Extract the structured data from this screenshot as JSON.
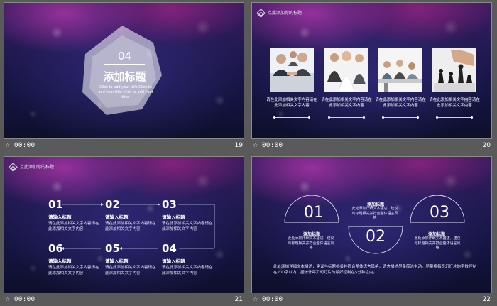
{
  "slides": [
    {
      "number": "19",
      "time": "00:00",
      "section_number": "04",
      "title": "添加标题",
      "subtitle": "Click to add your title Click to add your title Click to add your title."
    },
    {
      "number": "20",
      "time": "00:00",
      "header": "点此添加你的标题",
      "photos": [
        {
          "icon": "business-handshake-photo",
          "caption": "请在此添加相关文字内容请在此添加相关文字内容"
        },
        {
          "icon": "business-team-photo",
          "caption": "请在此添加相关文字内容请在此添加相关文字内容"
        },
        {
          "icon": "office-meeting-photo",
          "caption": "请在此添加相关文字内容请在此添加相关文字内容"
        },
        {
          "icon": "chess-strategy-photo",
          "caption": "请在此添加相关文字内容请在此添加相关文字内容"
        }
      ]
    },
    {
      "number": "21",
      "time": "00:00",
      "header": "点此添加你的标题",
      "steps": [
        {
          "num": "01",
          "title": "请输入标题",
          "desc": "请在此添加相关文字内容请在此添加相关文字内容"
        },
        {
          "num": "02",
          "title": "请输入标题",
          "desc": "请在此添加相关文字内容请在此添加相关文字内容"
        },
        {
          "num": "03",
          "title": "请输入标题",
          "desc": "请在此添加相关文字内容请在此添加相关文字内容"
        },
        {
          "num": "06",
          "title": "请输入标题",
          "desc": "请在此添加相关文字内容请在此添加相关文字内容"
        },
        {
          "num": "05",
          "title": "请输入标题",
          "desc": "请在此添加相关文字内容请在此添加相关文字内容"
        },
        {
          "num": "04",
          "title": "请输入标题",
          "desc": "请在此添加相关文字内容请在此添加相关文字内容"
        }
      ]
    },
    {
      "number": "22",
      "time": "00:00",
      "items": [
        {
          "num": "01",
          "title": "添加标题",
          "desc": "此处添加详细文本描述，建议与标题相关并符合整体语言风格"
        },
        {
          "num": "02",
          "title": "添加标题",
          "desc": "此处添加详细文本描述，建议与标题相关并符合整体语言风格"
        },
        {
          "num": "03",
          "title": "添加标题",
          "desc": "此处添加详细文本描述，建议与标题相关并符合整体语言风格"
        }
      ],
      "body": "此处添加详细文本描述，建议与标题相关并符合整体语言风格，语言描述尽量简洁生动。尽量将每页幻灯片的字数控制在200字以内，据统计每页幻灯片的最好控制在5分钟之内。"
    }
  ],
  "footer_icon": "star-icon",
  "colors": {
    "panel_bg": "#5a5a5a",
    "accent_line": "#cfcfe6"
  }
}
